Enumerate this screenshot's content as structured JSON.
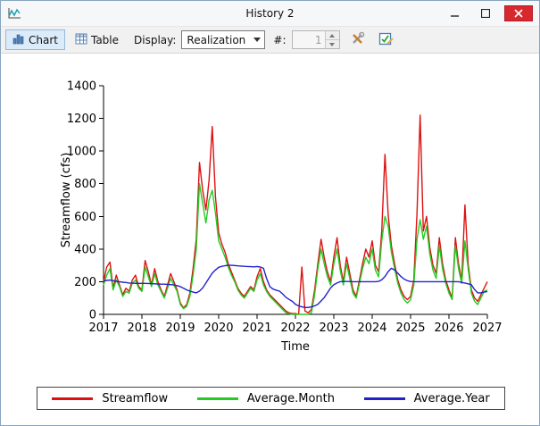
{
  "window": {
    "title": "History 2"
  },
  "toolbar": {
    "chart_label": "Chart",
    "table_label": "Table",
    "display_label": "Display:",
    "display_value": "Realization",
    "count_label": "#:",
    "count_value": "1"
  },
  "colors": {
    "streamflow": "#dd1111",
    "average_month": "#22cc22",
    "average_year": "#2222cc",
    "axis": "#000000",
    "selected_button_bg": "#dcebf9",
    "close_button": "#d9272e"
  },
  "chart_data": {
    "type": "line",
    "title": "",
    "xlabel": "Time",
    "ylabel": "Streamflow (cfs)",
    "xlim": [
      2017,
      2027
    ],
    "ylim": [
      0,
      1400
    ],
    "x_ticks": [
      2017,
      2018,
      2019,
      2020,
      2021,
      2022,
      2023,
      2024,
      2025,
      2026,
      2027
    ],
    "y_ticks": [
      0,
      200,
      400,
      600,
      800,
      1000,
      1200,
      1400
    ],
    "grid": false,
    "legend_position": "bottom",
    "x0": 2017,
    "dx": 0.0833333,
    "series": [
      {
        "name": "Streamflow",
        "color": "#dd1111",
        "values": [
          200,
          290,
          320,
          160,
          240,
          180,
          120,
          160,
          140,
          210,
          240,
          170,
          150,
          330,
          260,
          180,
          280,
          200,
          150,
          110,
          180,
          250,
          200,
          150,
          70,
          40,
          60,
          130,
          280,
          460,
          930,
          760,
          640,
          820,
          1150,
          720,
          500,
          430,
          380,
          310,
          260,
          210,
          160,
          130,
          110,
          140,
          170,
          150,
          230,
          280,
          200,
          150,
          120,
          100,
          80,
          60,
          40,
          20,
          10,
          5,
          5,
          0,
          290,
          20,
          10,
          30,
          150,
          310,
          460,
          350,
          260,
          200,
          350,
          470,
          300,
          200,
          350,
          250,
          150,
          110,
          210,
          310,
          400,
          350,
          450,
          300,
          260,
          510,
          980,
          610,
          420,
          310,
          210,
          150,
          110,
          90,
          110,
          210,
          620,
          1220,
          510,
          600,
          410,
          300,
          250,
          470,
          310,
          210,
          150,
          100,
          470,
          310,
          210,
          670,
          310,
          150,
          100,
          80,
          120,
          160,
          200
        ]
      },
      {
        "name": "Average.Month",
        "color": "#22cc22",
        "values": [
          180,
          240,
          280,
          150,
          210,
          170,
          110,
          140,
          130,
          190,
          210,
          160,
          140,
          290,
          230,
          170,
          250,
          180,
          140,
          100,
          160,
          220,
          180,
          140,
          60,
          35,
          50,
          110,
          240,
          400,
          800,
          680,
          560,
          700,
          760,
          620,
          450,
          400,
          350,
          290,
          240,
          200,
          150,
          120,
          100,
          130,
          160,
          140,
          210,
          250,
          180,
          140,
          110,
          90,
          70,
          50,
          30,
          10,
          5,
          0,
          0,
          0,
          0,
          0,
          0,
          10,
          120,
          280,
          400,
          310,
          230,
          180,
          310,
          400,
          270,
          180,
          310,
          220,
          130,
          100,
          190,
          280,
          350,
          310,
          400,
          270,
          230,
          450,
          600,
          540,
          380,
          280,
          190,
          130,
          90,
          70,
          90,
          180,
          460,
          580,
          460,
          540,
          370,
          270,
          220,
          420,
          280,
          190,
          130,
          90,
          420,
          280,
          190,
          450,
          280,
          130,
          80,
          60,
          100,
          140,
          150
        ]
      },
      {
        "name": "Average.Year",
        "color": "#2222cc",
        "values": [
          205,
          208,
          210,
          206,
          202,
          200,
          197,
          195,
          192,
          191,
          190,
          190,
          190,
          190,
          189,
          188,
          187,
          186,
          185,
          185,
          184,
          182,
          180,
          176,
          170,
          160,
          150,
          142,
          136,
          132,
          142,
          162,
          192,
          222,
          252,
          272,
          288,
          294,
          298,
          300,
          300,
          299,
          297,
          296,
          294,
          293,
          292,
          291,
          293,
          290,
          282,
          220,
          170,
          155,
          148,
          142,
          125,
          105,
          92,
          80,
          62,
          52,
          46,
          42,
          42,
          46,
          52,
          62,
          82,
          102,
          132,
          162,
          182,
          192,
          200,
          201,
          201,
          201,
          200,
          200,
          200,
          200,
          200,
          200,
          200,
          200,
          202,
          212,
          232,
          262,
          282,
          272,
          252,
          232,
          216,
          206,
          201,
          200,
          200,
          200,
          200,
          200,
          200,
          200,
          200,
          200,
          200,
          200,
          200,
          200,
          200,
          200,
          196,
          192,
          187,
          182,
          152,
          132,
          132,
          136,
          140
        ]
      }
    ]
  }
}
